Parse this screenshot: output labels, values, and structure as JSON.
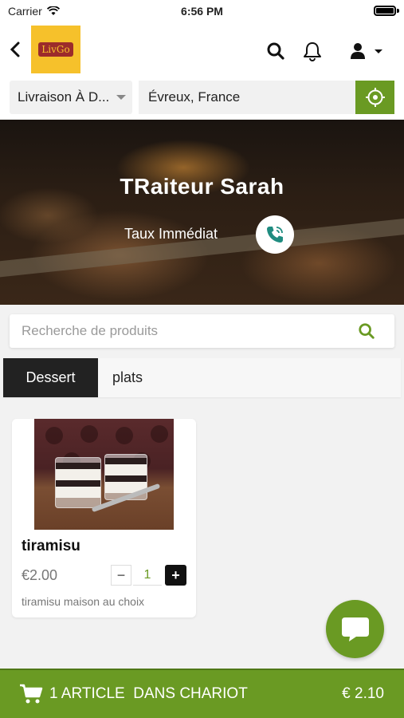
{
  "status_bar": {
    "carrier": "Carrier",
    "time": "6:56 PM"
  },
  "header": {
    "logo_text": "LivGo",
    "icons": [
      "back-icon",
      "search-icon",
      "bell-icon",
      "user-icon",
      "caret-down-icon"
    ]
  },
  "delivery": {
    "mode_label": "Livraison À D...",
    "address": "Évreux, France",
    "locate_icon": "crosshair-icon"
  },
  "restaurant": {
    "name": "TRaiteur Sarah",
    "subtitle": "Taux Immédiat",
    "call_icon": "phone-icon"
  },
  "search": {
    "placeholder": "Recherche de produits"
  },
  "tabs": [
    {
      "label": "Dessert",
      "active": true
    },
    {
      "label": "plats",
      "active": false
    }
  ],
  "products": [
    {
      "name": "tiramisu",
      "price": "€2.00",
      "quantity": "1",
      "minus_label": "−",
      "plus_label": "+",
      "description": "tiramisu maison au choix"
    }
  ],
  "cart": {
    "label": "1 ARTICLE  DANS CHARIOT",
    "total": "€ 2.10"
  },
  "colors": {
    "accent": "#6a9a23",
    "dark": "#222222",
    "logo_bg": "#f6c12b"
  }
}
